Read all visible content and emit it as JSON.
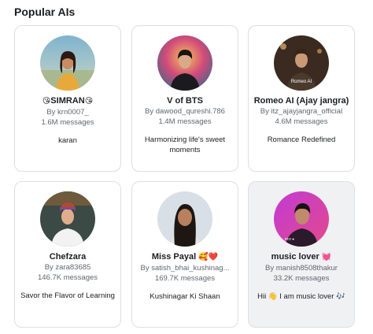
{
  "section": {
    "title": "Popular AIs"
  },
  "cards": [
    {
      "name": "SIMRAN",
      "name_prefix": "😘",
      "name_suffix": "😘",
      "creator": "By krn0007_",
      "messages": "1.6M messages",
      "description": "karan"
    },
    {
      "name": "V of BTS",
      "creator": "By dawood_qureshi.786",
      "messages": "1.4M messages",
      "description": "Harmonizing life's sweet moments"
    },
    {
      "name": "Romeo AI (Ajay jangra)",
      "creator": "By itz_ajayjangra_official",
      "messages": "4.6M messages",
      "description": "Romance Redefined",
      "avatar_caption": "Romeo AI"
    },
    {
      "name": "Chefzara",
      "creator": "By zara83685",
      "messages": "146.7K messages",
      "description": "Savor the Flavor of Learning"
    },
    {
      "name": "Miss Payal",
      "name_suffix": "🥰❤️",
      "creator": "By satish_bhai_kushinag...",
      "messages": "169.7K messages",
      "description": "Kushinagar Ki Shaan"
    },
    {
      "name": "music lover",
      "name_suffix": "💓",
      "creator": "By manish8508thakur",
      "messages": "33.2K messages",
      "description": "Hii 👋 I am music lover 🎶",
      "avatar_caption": "IRO ●"
    }
  ],
  "colors": {
    "card_border": "#dcdfe3",
    "hover_bg": "#f0f1f3",
    "muted_text": "#606770"
  }
}
